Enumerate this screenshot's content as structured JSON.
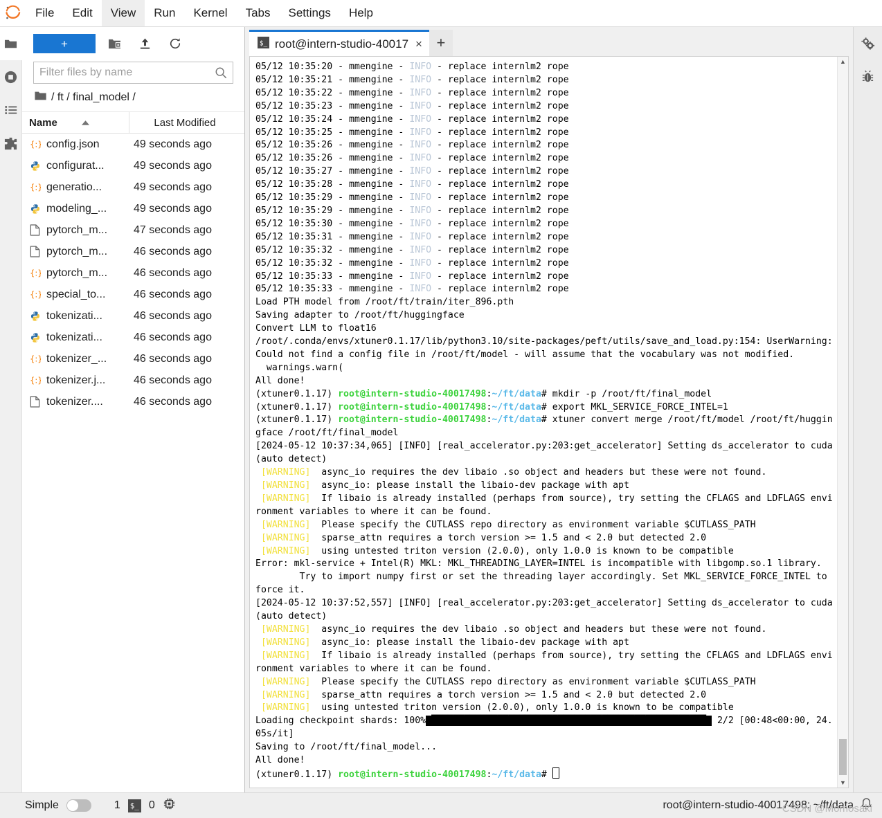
{
  "menu": {
    "items": [
      {
        "label": "File",
        "active": false
      },
      {
        "label": "Edit",
        "active": false
      },
      {
        "label": "View",
        "active": true
      },
      {
        "label": "Run",
        "active": false
      },
      {
        "label": "Kernel",
        "active": false
      },
      {
        "label": "Tabs",
        "active": false
      },
      {
        "label": "Settings",
        "active": false
      },
      {
        "label": "Help",
        "active": false
      }
    ]
  },
  "left_rail": {
    "items": [
      {
        "name": "file-browser-icon",
        "label": "folder-icon",
        "selected": true
      },
      {
        "name": "running-terminals-icon",
        "label": "stop-circle-icon",
        "selected": false
      },
      {
        "name": "table-of-contents-icon",
        "label": "list-icon",
        "selected": false
      },
      {
        "name": "extension-manager-icon",
        "label": "puzzle-icon",
        "selected": false
      }
    ]
  },
  "right_rail": {
    "items": [
      {
        "name": "property-inspector-icon",
        "label": "gears-icon"
      },
      {
        "name": "debugger-icon",
        "label": "bug-icon"
      }
    ]
  },
  "filebrowser": {
    "new_launcher_label": "+",
    "toolbar_icons": [
      "new-folder-icon",
      "upload-icon",
      "refresh-icon"
    ],
    "filter_placeholder": "Filter files by name",
    "filter_value": "",
    "breadcrumb": "/ ft / final_model /",
    "columns": {
      "name": "Name",
      "last_modified": "Last Modified"
    },
    "sort_direction": "ascending",
    "files": [
      {
        "name": "config.json",
        "modified": "49 seconds ago",
        "icon": "json-icon"
      },
      {
        "name": "configurat...",
        "modified": "49 seconds ago",
        "icon": "python-icon"
      },
      {
        "name": "generatio...",
        "modified": "49 seconds ago",
        "icon": "json-icon"
      },
      {
        "name": "modeling_...",
        "modified": "49 seconds ago",
        "icon": "python-icon"
      },
      {
        "name": "pytorch_m...",
        "modified": "47 seconds ago",
        "icon": "file-icon"
      },
      {
        "name": "pytorch_m...",
        "modified": "46 seconds ago",
        "icon": "file-icon"
      },
      {
        "name": "pytorch_m...",
        "modified": "46 seconds ago",
        "icon": "json-icon"
      },
      {
        "name": "special_to...",
        "modified": "46 seconds ago",
        "icon": "json-icon"
      },
      {
        "name": "tokenizati...",
        "modified": "46 seconds ago",
        "icon": "python-icon"
      },
      {
        "name": "tokenizati...",
        "modified": "46 seconds ago",
        "icon": "python-icon"
      },
      {
        "name": "tokenizer_...",
        "modified": "46 seconds ago",
        "icon": "json-icon"
      },
      {
        "name": "tokenizer.j...",
        "modified": "46 seconds ago",
        "icon": "json-icon"
      },
      {
        "name": "tokenizer....",
        "modified": "46 seconds ago",
        "icon": "file-icon"
      }
    ]
  },
  "dock": {
    "tab_title": "root@intern-studio-40017",
    "tab_icon": "terminal-icon",
    "tab_close": "×",
    "add_tab": "+"
  },
  "terminal": {
    "info_lines": [
      "05/12 10:35:20 - mmengine - ",
      "05/12 10:35:21 - mmengine - ",
      "05/12 10:35:22 - mmengine - ",
      "05/12 10:35:23 - mmengine - ",
      "05/12 10:35:24 - mmengine - ",
      "05/12 10:35:25 - mmengine - ",
      "05/12 10:35:26 - mmengine - ",
      "05/12 10:35:26 - mmengine - ",
      "05/12 10:35:27 - mmengine - ",
      "05/12 10:35:28 - mmengine - ",
      "05/12 10:35:29 - mmengine - ",
      "05/12 10:35:29 - mmengine - ",
      "05/12 10:35:30 - mmengine - ",
      "05/12 10:35:31 - mmengine - ",
      "05/12 10:35:32 - mmengine - ",
      "05/12 10:35:32 - mmengine - ",
      "05/12 10:35:33 - mmengine - ",
      "05/12 10:35:33 - mmengine - "
    ],
    "info_token": "INFO",
    "info_suffix": " - replace internlm2 rope",
    "block1": [
      "Load PTH model from /root/ft/train/iter_896.pth",
      "Saving adapter to /root/ft/huggingface",
      "Convert LLM to float16",
      "/root/.conda/envs/xtuner0.1.17/lib/python3.10/site-packages/peft/utils/save_and_load.py:154: UserWarning: Could not find a config file in /root/ft/model - will assume that the vocabulary was not modified.",
      "  warnings.warn(",
      "All done!"
    ],
    "prompt_env": "(xtuner0.1.17) ",
    "prompt_user": "root@intern-studio-40017498",
    "prompt_sep": ":",
    "prompt_path": "~/ft/data",
    "prompt_hash": "# ",
    "commands": [
      "mkdir -p /root/ft/final_model",
      "export MKL_SERVICE_FORCE_INTEL=1",
      "xtuner convert merge /root/ft/model /root/ft/huggingface /root/ft/final_model"
    ],
    "accel_line_1": "[2024-05-12 10:37:34,065] [INFO] [real_accelerator.py:203:get_accelerator] Setting ds_accelerator to cuda (auto detect)",
    "accel_line_2": "[2024-05-12 10:37:52,557] [INFO] [real_accelerator.py:203:get_accelerator] Setting ds_accelerator to cuda (auto detect)",
    "warn_token": "[WARNING]",
    "warnings_group_1": [
      "  async_io requires the dev libaio .so object and headers but these were not found.",
      "  async_io: please install the libaio-dev package with apt",
      "  If libaio is already installed (perhaps from source), try setting the CFLAGS and LDFLAGS environment variables to where it can be found.",
      "  Please specify the CUTLASS repo directory as environment variable $CUTLASS_PATH",
      "  sparse_attn requires a torch version >= 1.5 and < 2.0 but detected 2.0",
      "  using untested triton version (2.0.0), only 1.0.0 is known to be compatible"
    ],
    "warnings_group_2": [
      "  async_io requires the dev libaio .so object and headers but these were not found.",
      "  async_io: please install the libaio-dev package with apt",
      "  If libaio is already installed (perhaps from source), try setting the CFLAGS and LDFLAGS environment variables to where it can be found.",
      "  Please specify the CUTLASS repo directory as environment variable $CUTLASS_PATH",
      "  sparse_attn requires a torch version >= 1.5 and < 2.0 but detected 2.0",
      "  using untested triton version (2.0.0), only 1.0.0 is known to be compatible"
    ],
    "error_lines": [
      "Error: mkl-service + Intel(R) MKL: MKL_THREADING_LAYER=INTEL is incompatible with libgomp.so.1 library.",
      "\tTry to import numpy first or set the threading layer accordingly. Set MKL_SERVICE_FORCE_INTEL to force it."
    ],
    "progress": {
      "label": "Loading checkpoint shards: 100%",
      "bar": "|██████████████████████████████████████████████████|",
      "stats": " 2/2 [00:48<00:00, 24.05s/it]"
    },
    "tail_lines": [
      "Saving to /root/ft/final_model...",
      "All done!"
    ]
  },
  "statusbar": {
    "simple_label": "Simple",
    "simple_on": false,
    "kernel_count": "1",
    "terminal_count": "0",
    "terminal_icon": "$_",
    "cpu_icon": "cpu-icon",
    "right_text": "root@intern-studio-40017498: ~/ft/data",
    "notification_icon": "bell-icon",
    "watermark": "CSDN @Momosaki"
  },
  "colors": {
    "accent": "#1976d2",
    "warning": "#f2e03c",
    "info": "#b9c6d6",
    "prompt_user": "#3bd23b",
    "prompt_path": "#5ab9e8"
  }
}
